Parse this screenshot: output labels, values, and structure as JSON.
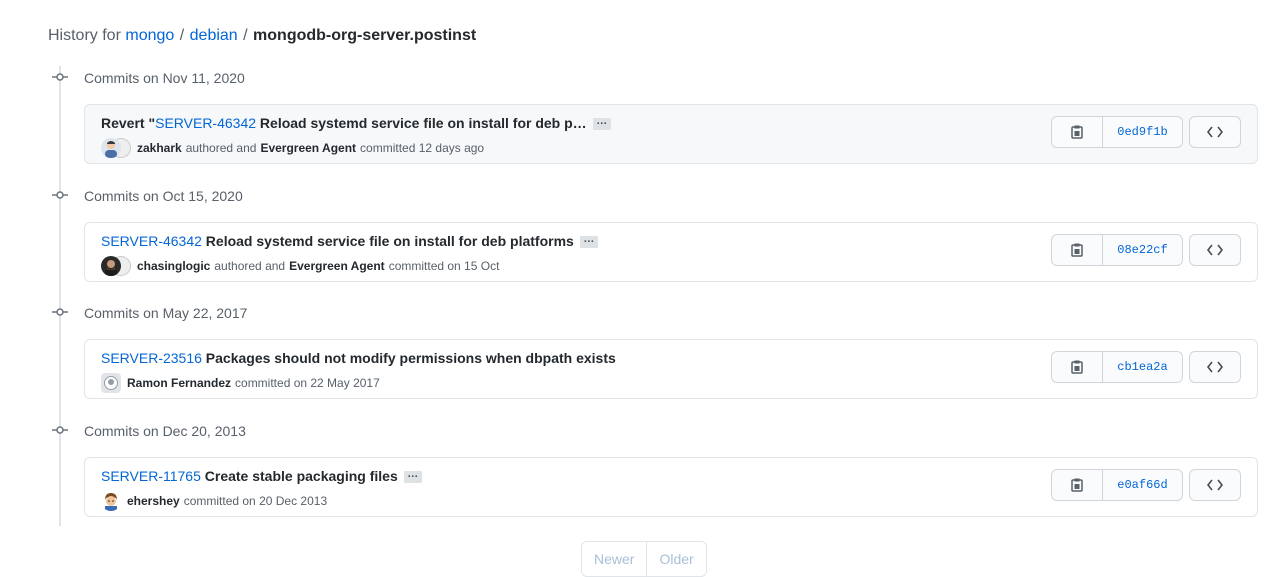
{
  "breadcrumb": {
    "prefix": "History for",
    "repo_owner": "mongo",
    "sep1": "/",
    "folder": "debian",
    "sep2": "/",
    "file": "mongodb-org-server.postinst"
  },
  "groups": [
    {
      "title": "Commits on Nov 11, 2020",
      "commit": {
        "title_prefix": "Revert \"",
        "issue": "SERVER-46342",
        "message": " Reload systemd service file on install for deb p…",
        "has_ellipsis": true,
        "ellipsis_label": "…",
        "author": "zakhark",
        "authored_text": "authored and",
        "committer": "Evergreen Agent",
        "committed_text": "committed 12 days ago",
        "sha": "0ed9f1b"
      }
    },
    {
      "title": "Commits on Oct 15, 2020",
      "commit": {
        "title_prefix": "",
        "issue": "SERVER-46342",
        "message": " Reload systemd service file on install for deb platforms",
        "has_ellipsis": true,
        "ellipsis_label": "…",
        "author": "chasinglogic",
        "authored_text": "authored and",
        "committer": "Evergreen Agent",
        "committed_text": "committed on 15 Oct",
        "sha": "08e22cf"
      }
    },
    {
      "title": "Commits on May 22, 2017",
      "commit": {
        "title_prefix": "",
        "issue": "SERVER-23516",
        "message": " Packages should not modify permissions when dbpath exists",
        "has_ellipsis": false,
        "author": "Ramon Fernandez",
        "committed_text": "committed on 22 May 2017",
        "sha": "cb1ea2a"
      }
    },
    {
      "title": "Commits on Dec 20, 2013",
      "commit": {
        "title_prefix": "",
        "issue": "SERVER-11765",
        "message": " Create stable packaging files",
        "has_ellipsis": true,
        "ellipsis_label": "…",
        "author": "ehershey",
        "committed_text": "committed on 20 Dec 2013",
        "sha": "e0af66d"
      }
    }
  ],
  "pagination": {
    "newer": "Newer",
    "older": "Older"
  },
  "icons": {
    "commit": "git-commit-icon",
    "copy": "clipboard-icon",
    "browse": "code-icon"
  },
  "colors": {
    "link": "#0366d6",
    "muted": "#586069",
    "border": "#e1e4e8"
  }
}
